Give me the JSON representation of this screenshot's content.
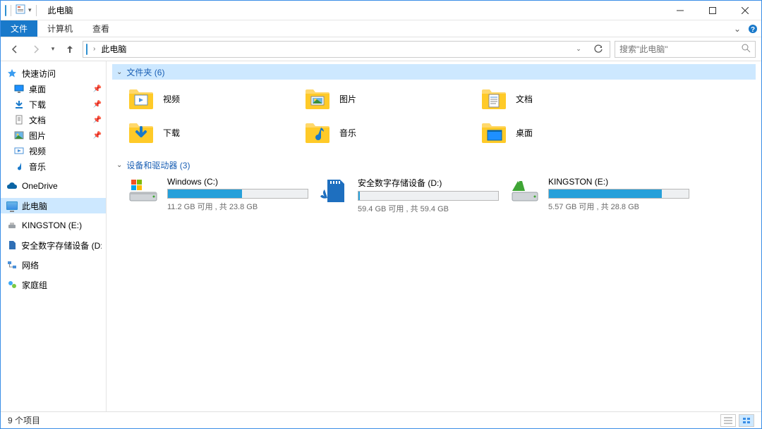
{
  "title": "此电脑",
  "menubar": {
    "file": "文件",
    "computer": "计算机",
    "view": "查看"
  },
  "nav": {
    "refresh_title": "刷新"
  },
  "address": {
    "location": "此电脑",
    "chevron": "›"
  },
  "search": {
    "placeholder": "搜索\"此电脑\""
  },
  "sidebar": {
    "quick_access": "快速访问",
    "quick_items": [
      {
        "label": "桌面",
        "pinned": true,
        "icon": "desktop"
      },
      {
        "label": "下载",
        "pinned": true,
        "icon": "downloads"
      },
      {
        "label": "文档",
        "pinned": true,
        "icon": "documents"
      },
      {
        "label": "图片",
        "pinned": true,
        "icon": "pictures"
      },
      {
        "label": "视频",
        "pinned": false,
        "icon": "videos"
      },
      {
        "label": "音乐",
        "pinned": false,
        "icon": "music"
      }
    ],
    "onedrive": "OneDrive",
    "this_pc": "此电脑",
    "kingston": "KINGSTON (E:)",
    "secure_sd": "安全数字存储设备 (D:)",
    "network": "网络",
    "homegroup": "家庭组"
  },
  "groups": {
    "folders": {
      "label": "文件夹",
      "count": 6
    },
    "drives": {
      "label": "设备和驱动器",
      "count": 3
    }
  },
  "folders": [
    {
      "label": "视频",
      "icon": "videos"
    },
    {
      "label": "图片",
      "icon": "pictures"
    },
    {
      "label": "文档",
      "icon": "documents"
    },
    {
      "label": "下载",
      "icon": "downloads"
    },
    {
      "label": "音乐",
      "icon": "music"
    },
    {
      "label": "桌面",
      "icon": "desktop"
    }
  ],
  "drives": [
    {
      "name": "Windows (C:)",
      "free": "11.2 GB",
      "total": "23.8 GB",
      "fill_pct": 53,
      "icon": "disk-windows"
    },
    {
      "name": "安全数字存储设备 (D:)",
      "free": "59.4 GB",
      "total": "59.4 GB",
      "fill_pct": 1,
      "icon": "sd-card"
    },
    {
      "name": "KINGSTON (E:)",
      "free": "5.57 GB",
      "total": "28.8 GB",
      "fill_pct": 81,
      "icon": "usb-drive"
    }
  ],
  "drive_text": {
    "free_word": "可用",
    "sep": " , 共 "
  },
  "status": {
    "items_label": "个项目",
    "count": 9
  }
}
